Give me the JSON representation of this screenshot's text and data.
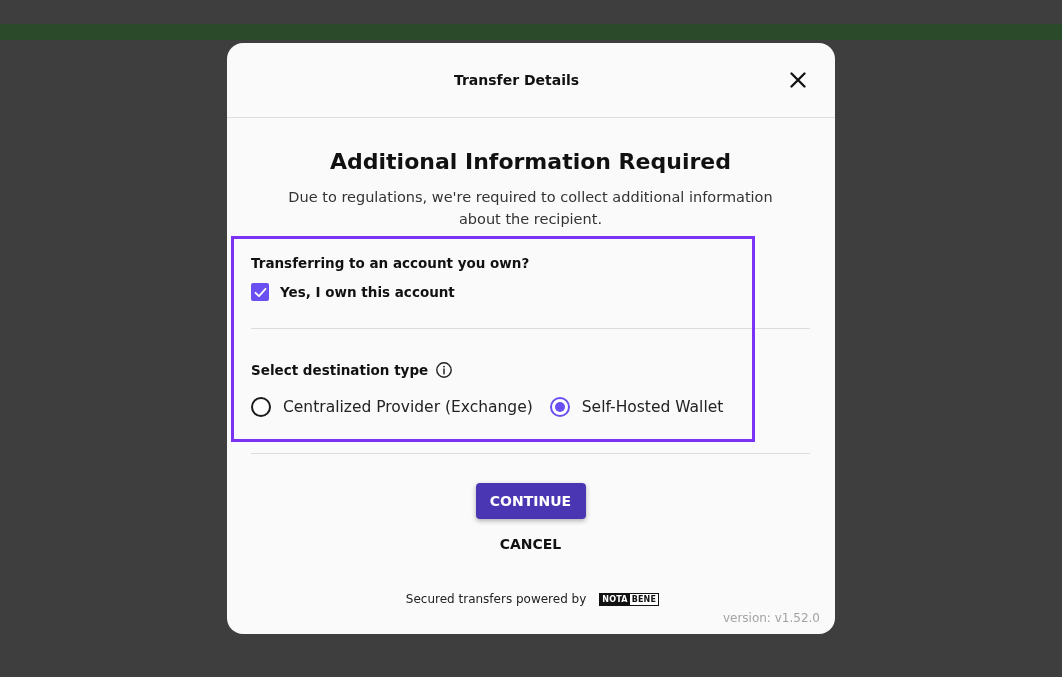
{
  "dialog": {
    "title": "Transfer Details",
    "heading": "Additional Information Required",
    "description": "Due to regulations, we're required to collect additional information about the recipient.",
    "ownership": {
      "label": "Transferring to an account you own?",
      "checkbox": {
        "label": "Yes, I own this account",
        "checked": true
      }
    },
    "destination": {
      "label": "Select destination type",
      "options": [
        {
          "label": "Centralized Provider (Exchange)",
          "selected": false
        },
        {
          "label": "Self-Hosted Wallet",
          "selected": true
        }
      ]
    },
    "buttons": [
      {
        "label": "CONTINUE",
        "kind": "primary"
      },
      {
        "label": "CANCEL",
        "kind": "text"
      }
    ],
    "footer": {
      "text": "Secured transfers powered by",
      "logo": [
        "NOTA",
        "BENE"
      ]
    },
    "version": "version: v1.52.0"
  }
}
